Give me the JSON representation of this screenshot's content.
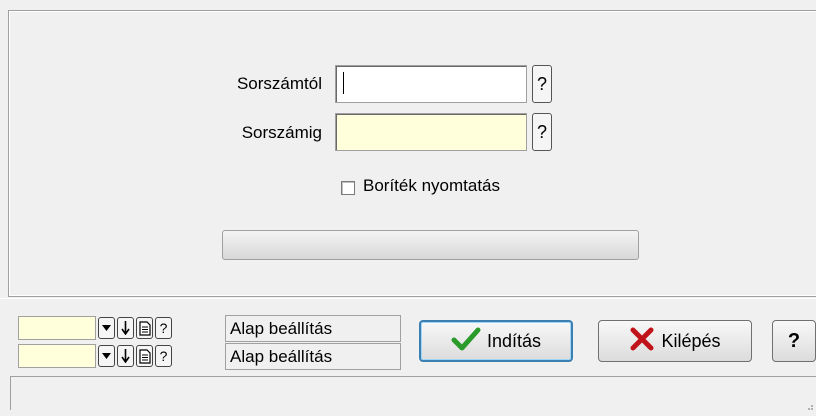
{
  "form": {
    "from_label": "Sorszámtól",
    "from_value": "",
    "to_label": "Sorszámig",
    "to_value": "",
    "help_glyph": "?",
    "envelope_label": "Boríték nyomtatás",
    "envelope_checked": false,
    "progress": 0
  },
  "settings_rows": [
    {
      "value": "",
      "dropdown_icon": "dropdown-arrow-icon",
      "down_icon": "arrow-down-icon",
      "doc_icon": "document-icon",
      "help_glyph": "?",
      "label": "Alap beállítás"
    },
    {
      "value": "",
      "dropdown_icon": "dropdown-arrow-icon",
      "down_icon": "arrow-down-icon",
      "doc_icon": "document-icon",
      "help_glyph": "?",
      "label": "Alap beállítás"
    }
  ],
  "actions": {
    "start_label": "Indítás",
    "start_icon": "checkmark-icon",
    "exit_label": "Kilépés",
    "exit_icon": "x-mark-icon",
    "help_glyph": "?"
  },
  "colors": {
    "window_bg": "#f0f0f0",
    "required_field_bg": "#ffffdc",
    "check_green": "#2a9a2a",
    "exit_red": "#c0141a"
  }
}
